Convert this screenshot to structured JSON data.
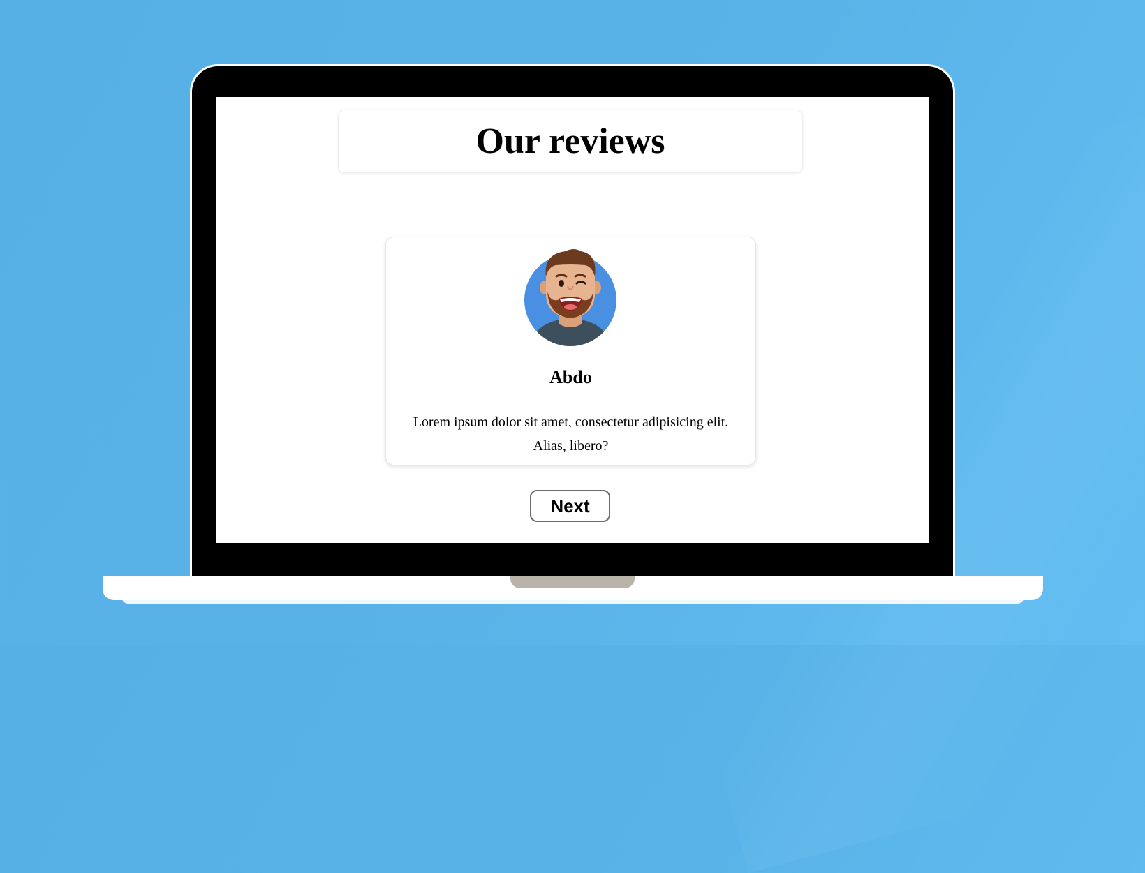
{
  "page": {
    "title": "Our reviews",
    "review": {
      "name": "Abdo",
      "text": "Lorem ipsum dolor sit amet, consectetur adipisicing elit. Alias, libero?",
      "avatar_icon": "winking-bearded-man-avatar"
    },
    "next_label": "Next"
  },
  "colors": {
    "background": "#59b3e8",
    "avatar_bg": "#4a90e2",
    "laptop_bezel": "#000000"
  }
}
